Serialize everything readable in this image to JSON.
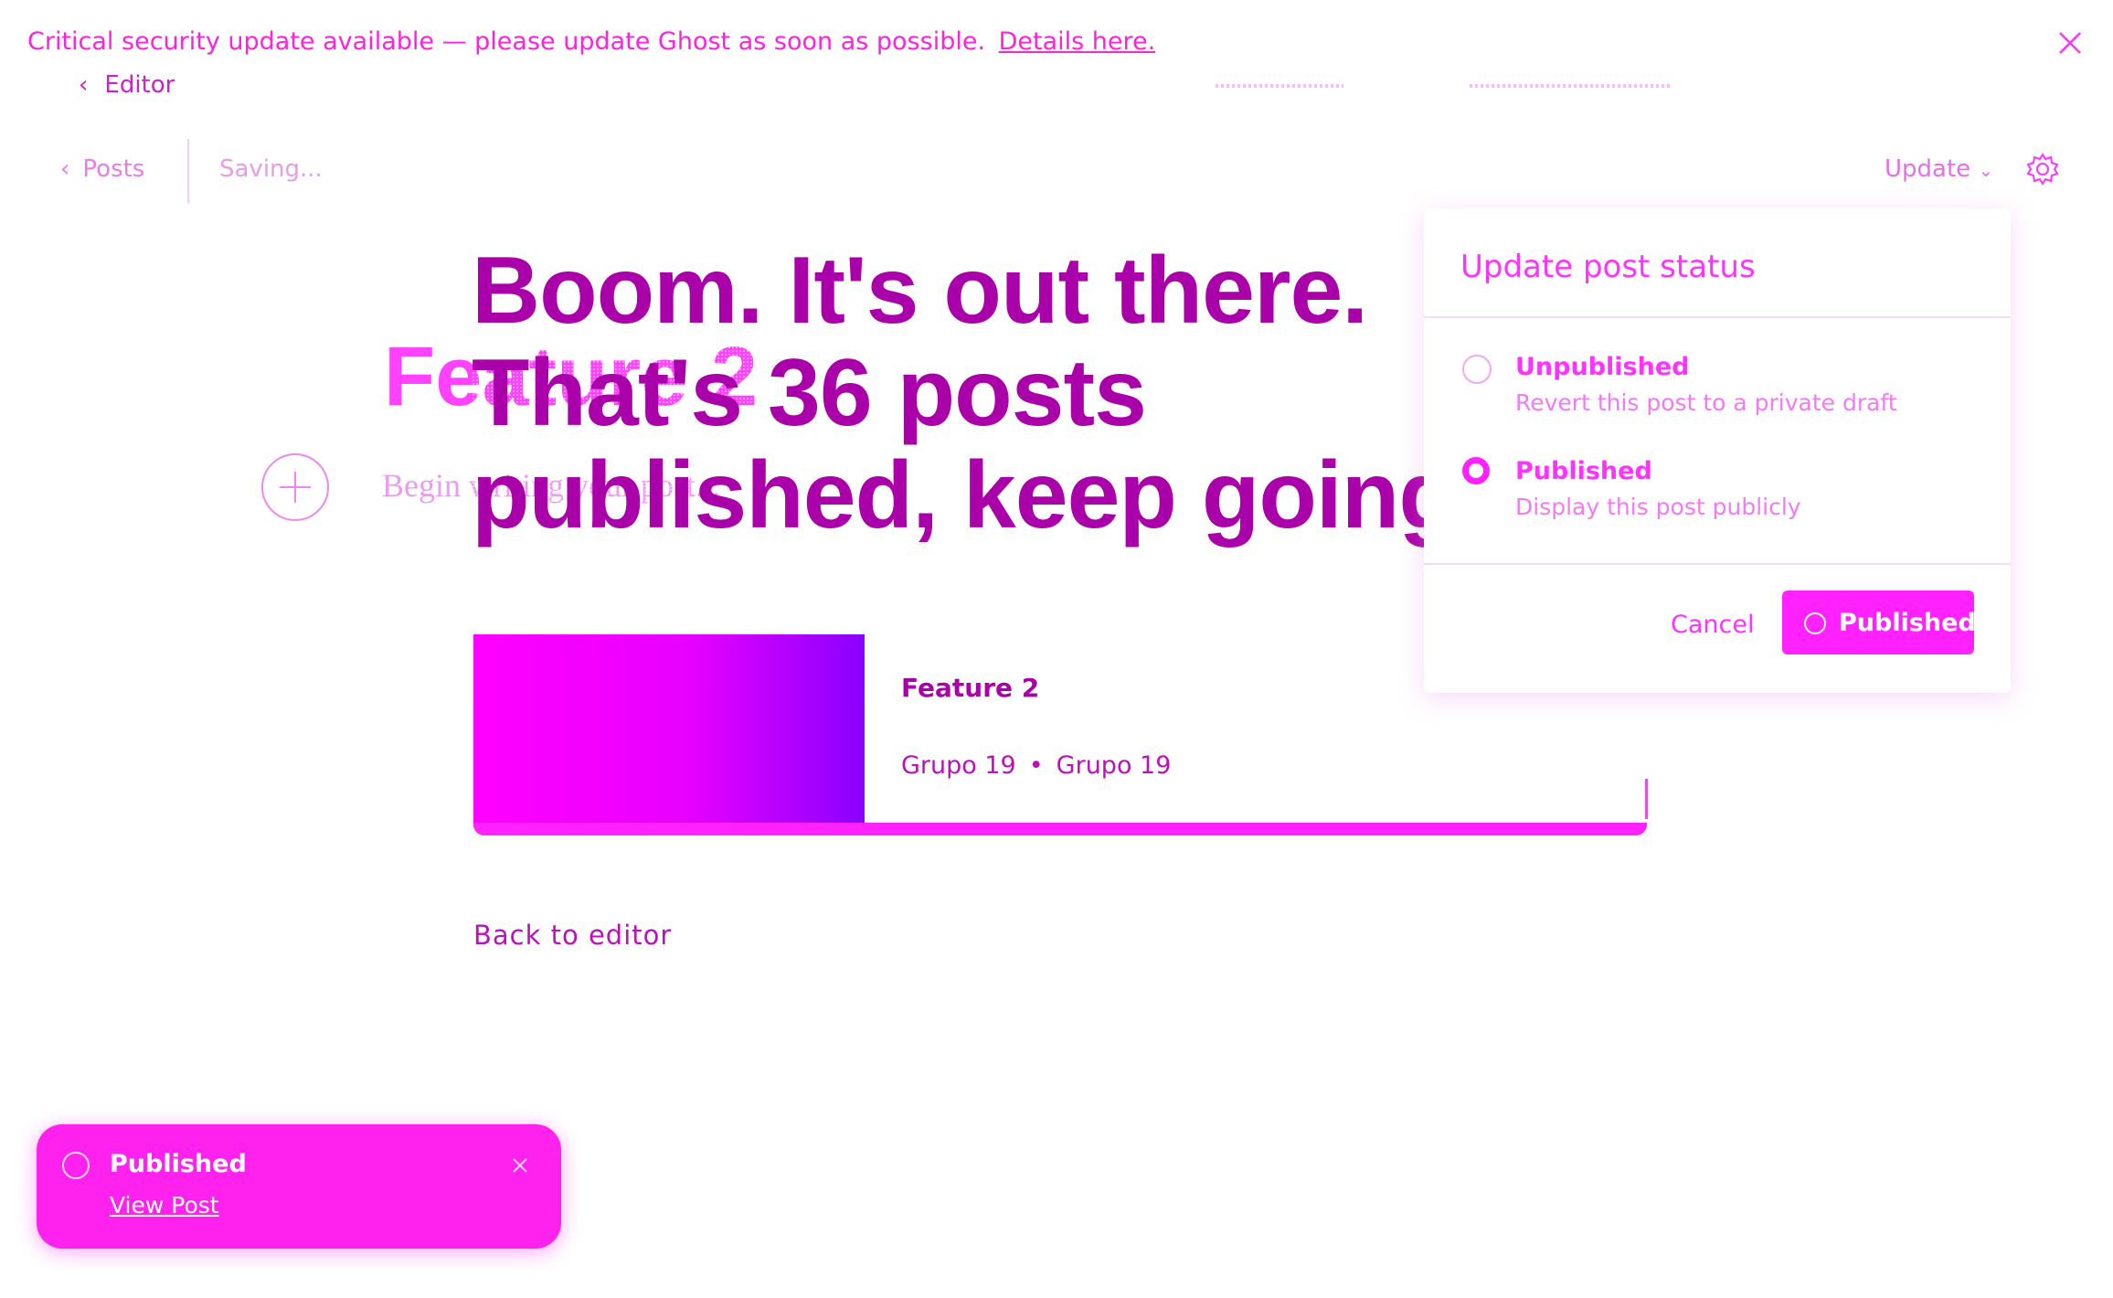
{
  "banner": {
    "message": "Critical security update available — please update Ghost as soon as possible.",
    "link": "Details here."
  },
  "top_nav": {
    "editor_label": "Editor"
  },
  "header": {
    "back_label": "Posts",
    "status": "Saving...",
    "update_label": "Update"
  },
  "editor": {
    "title_text": "Feature 2",
    "placeholder": "Begin writing your post..."
  },
  "publish_modal": {
    "headline": "Boom. It's out there. That's 36 posts published, keep going!",
    "card": {
      "title": "Feature 2",
      "author": "Grupo 19",
      "separator": "•",
      "author2": "Grupo 19"
    },
    "back_label": "Back to editor"
  },
  "status_popup": {
    "title": "Update post status",
    "options": [
      {
        "label": "Unpublished",
        "description": "Revert this post to a private draft",
        "selected": false
      },
      {
        "label": "Published",
        "description": "Display this post publicly",
        "selected": true
      }
    ],
    "cancel_label": "Cancel",
    "confirm_label": "Published"
  },
  "toast": {
    "title": "Published",
    "link": "View Post"
  },
  "colors": {
    "accent": "#ff22ff",
    "headline": "#aa00aa",
    "background": "#ffffff"
  }
}
